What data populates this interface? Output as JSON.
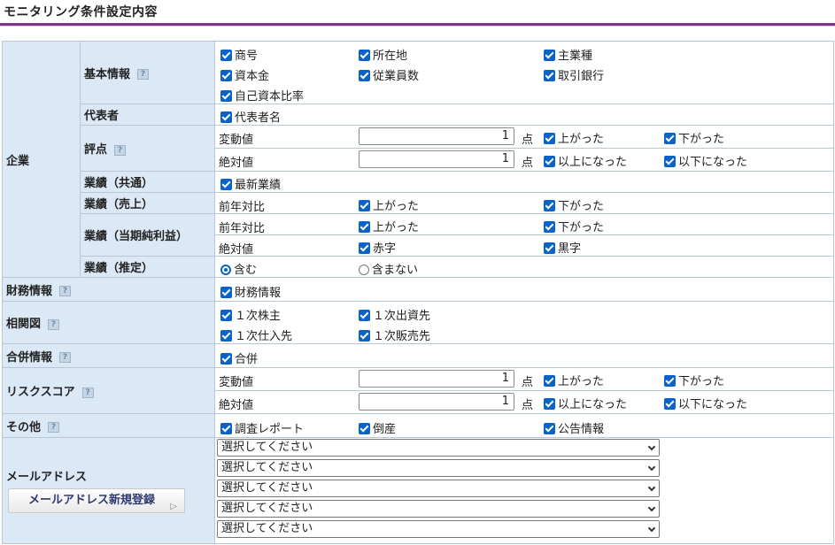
{
  "page_title": "モニタリング条件設定内容",
  "help_glyph": "?",
  "company": {
    "label": "企業",
    "basic": {
      "label": "基本情報",
      "items": [
        "商号",
        "所在地",
        "主業種",
        "資本金",
        "従業員数",
        "取引銀行",
        "自己資本比率"
      ]
    },
    "rep": {
      "label": "代表者",
      "items": [
        "代表者名"
      ]
    },
    "score": {
      "label": "評点",
      "change": {
        "label": "変動値",
        "value": "1",
        "unit": "点",
        "opt1": "上がった",
        "opt2": "下がった"
      },
      "absolute": {
        "label": "絶対値",
        "value": "1",
        "unit": "点",
        "opt1": "以上になった",
        "opt2": "以下になった"
      }
    },
    "perf_common": {
      "label": "業績（共通）",
      "items": [
        "最新業績"
      ]
    },
    "perf_sales": {
      "label": "業績（売上）",
      "row_label": "前年対比",
      "opt1": "上がった",
      "opt2": "下がった"
    },
    "perf_net": {
      "label": "業績（当期純利益）",
      "row1": {
        "label": "前年対比",
        "opt1": "上がった",
        "opt2": "下がった"
      },
      "row2": {
        "label": "絶対値",
        "opt1": "赤字",
        "opt2": "黒字"
      }
    },
    "perf_est": {
      "label": "業績（推定）",
      "radio1": "含む",
      "radio2": "含まない",
      "selected": "含む"
    }
  },
  "finance": {
    "label": "財務情報",
    "items": [
      "財務情報"
    ]
  },
  "relation": {
    "label": "相関図",
    "items": [
      "１次株主",
      "１次出資先",
      "１次仕入先",
      "１次販売先"
    ]
  },
  "merger": {
    "label": "合併情報",
    "items": [
      "合併"
    ]
  },
  "risk": {
    "label": "リスクスコア",
    "change": {
      "label": "変動値",
      "value": "1",
      "unit": "点",
      "opt1": "上がった",
      "opt2": "下がった"
    },
    "absolute": {
      "label": "絶対値",
      "value": "1",
      "unit": "点",
      "opt1": "以上になった",
      "opt2": "以下になった"
    }
  },
  "other": {
    "label": "その他",
    "items": [
      "調査レポート",
      "倒産",
      "公告情報"
    ]
  },
  "email": {
    "label": "メールアドレス",
    "register_button": "メールアドレス新規登録",
    "select_placeholder": "選択してください"
  },
  "colors": {
    "accent": "#7a3a84",
    "label_bg": "#dbe8f5",
    "checkbox": "#0b63c7"
  }
}
